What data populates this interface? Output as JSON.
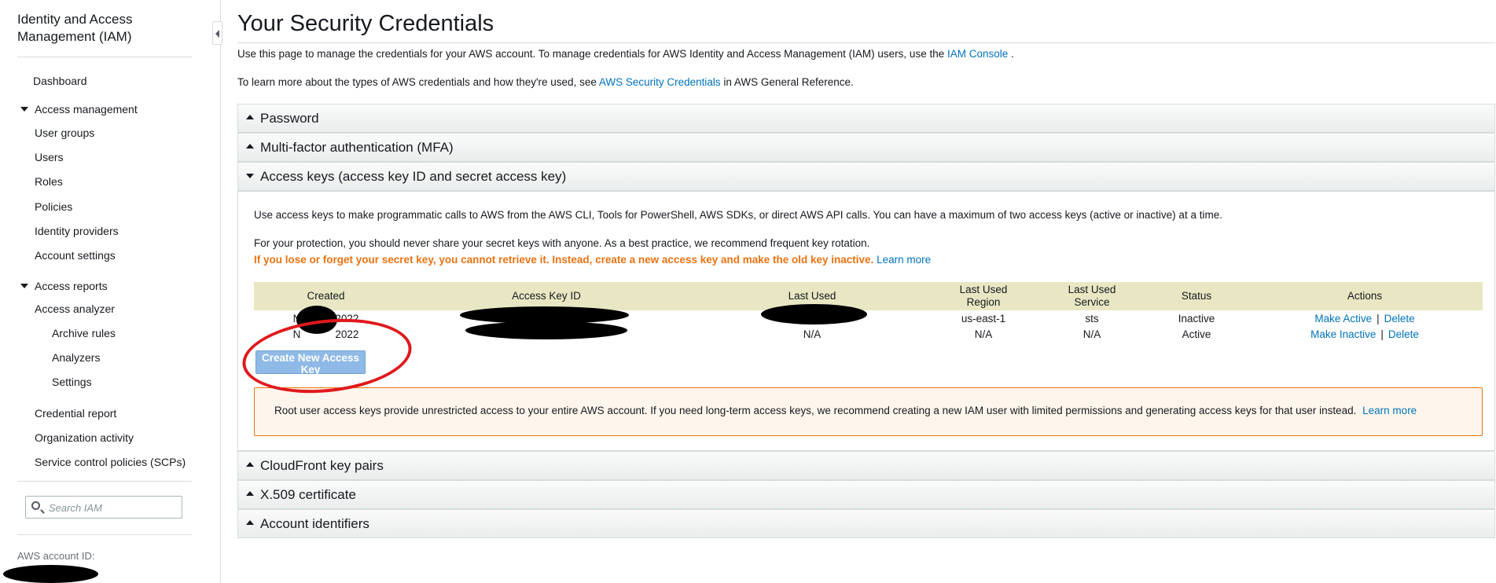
{
  "sidebar": {
    "title": "Identity and Access Management (IAM)",
    "dashboard": "Dashboard",
    "access_management": {
      "label": "Access management",
      "items": [
        "User groups",
        "Users",
        "Roles",
        "Policies",
        "Identity providers",
        "Account settings"
      ]
    },
    "access_reports": {
      "label": "Access reports",
      "analyzer": "Access analyzer",
      "analyzer_items": [
        "Archive rules",
        "Analyzers",
        "Settings"
      ],
      "items": [
        "Credential report",
        "Organization activity",
        "Service control policies (SCPs)"
      ]
    },
    "search": {
      "placeholder": "Search IAM"
    },
    "account_id_label": "AWS account ID:"
  },
  "main": {
    "title": "Your Security Credentials",
    "intro1": {
      "text": "Use this page to manage the credentials for your AWS account. To manage credentials for AWS Identity and Access Management (IAM) users, use the ",
      "link": "IAM Console",
      "suffix": " ."
    },
    "intro2": {
      "text": "To learn more about the types of AWS credentials and how they're used, see ",
      "link": "AWS Security Credentials",
      "suffix": " in AWS General Reference."
    },
    "sections": {
      "password": "Password",
      "mfa": "Multi-factor authentication (MFA)",
      "access_keys": "Access keys (access key ID and secret access key)",
      "cloudfront": "CloudFront key pairs",
      "x509": "X.509 certificate",
      "account_ids": "Account identifiers"
    },
    "access_keys": {
      "desc": "Use access keys to make programmatic calls to AWS from the AWS CLI, Tools for PowerShell, AWS SDKs, or direct AWS API calls. You can have a maximum of two access keys (active or inactive) at a time.",
      "protection": "For your protection, you should never share your secret keys with anyone. As a best practice, we recommend frequent key rotation.",
      "warning": "If you lose or forget your secret key, you cannot retrieve it. Instead, create a new access key and make the old key inactive.",
      "learn_more": "Learn more",
      "table": {
        "headers": {
          "created": "Created",
          "key_id": "Access Key ID",
          "last_used": "Last Used",
          "region_1": "Last Used",
          "region_2": "Region",
          "service_1": "Last Used",
          "service_2": "Service",
          "status": "Status",
          "actions": "Actions"
        },
        "rows": [
          {
            "created_pre": "N",
            "created_post": "2022",
            "last_used": "",
            "region": "us-east-1",
            "service": "sts",
            "status": "Inactive",
            "action1": "Make Active",
            "action2": "Delete"
          },
          {
            "created_pre": "N",
            "created_post": "2022",
            "last_used": "N/A",
            "region": "N/A",
            "service": "N/A",
            "status": "Active",
            "action1": "Make Inactive",
            "action2": "Delete"
          }
        ],
        "separator": "|"
      },
      "create_button": "Create New Access Key",
      "alert": {
        "text": "Root user access keys provide unrestricted access to your entire AWS account. If you need long-term access keys, we recommend creating a new IAM user with limited permissions and generating access keys for that user instead.",
        "link": "Learn more"
      }
    }
  },
  "colors": {
    "link": "#0073bb",
    "warning": "#ec7211",
    "table_header": "#e9e7c3",
    "annotation": "#e0191d"
  }
}
